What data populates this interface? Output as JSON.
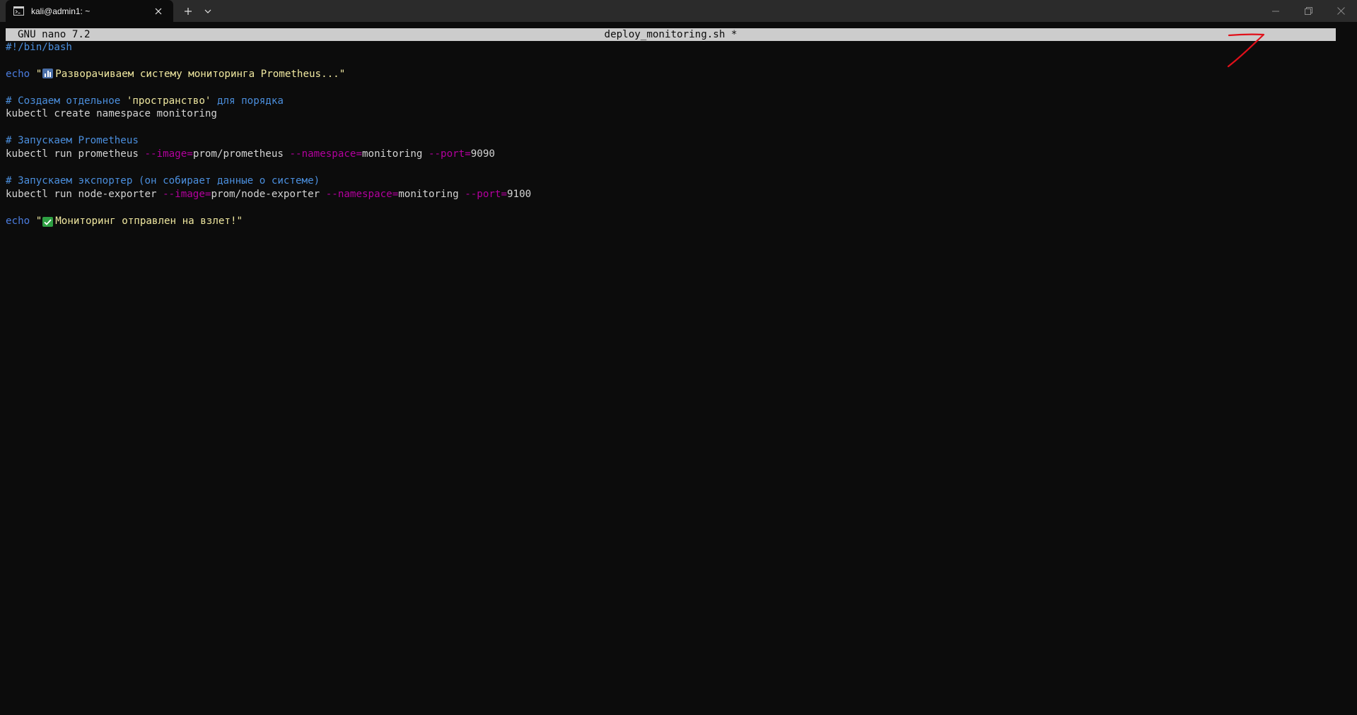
{
  "tab": {
    "icon": "terminal-icon",
    "title": "kali@admin1: ~"
  },
  "window_controls": [
    "minimize-icon",
    "restore-icon",
    "close-icon"
  ],
  "nano": {
    "version": "GNU nano 7.2",
    "filename": "deploy_monitoring.sh",
    "modified_marker": "*"
  },
  "editor": {
    "shebang": "#!/bin/bash",
    "echo1": {
      "keyword": "echo",
      "quote_open": "\"",
      "emoji": "bar-chart-emoji",
      "text": "Разворачиваем систему мониторинга Prometheus...\""
    },
    "comment1": {
      "part1": "# Создаем отдельное ",
      "quoted": "'пространство'",
      "part2": " для порядка"
    },
    "cmd1": "kubectl create namespace monitoring",
    "comment2": "# Запускаем Prometheus",
    "cmd2": {
      "base": "kubectl run prometheus ",
      "flag1": "--image=",
      "val1": "prom/prometheus ",
      "flag2": "--namespace=",
      "val2": "monitoring ",
      "flag3": "--port=",
      "val3": "9090"
    },
    "comment3": "# Запускаем экспортер (он собирает данные о системе)",
    "cmd3": {
      "base": "kubectl run node-exporter ",
      "flag1": "--image=",
      "val1": "prom/node-exporter ",
      "flag2": "--namespace=",
      "val2": "monitoring ",
      "flag3": "--port=",
      "val3": "9100"
    },
    "echo2": {
      "keyword": "echo",
      "quote_open": "\"",
      "emoji": "check-mark-emoji",
      "text": "Мониторинг отправлен на взлет!\""
    }
  },
  "colors": {
    "background": "#0c0c0c",
    "tabbar": "#2b2b2b",
    "header_bar": "#cccccc",
    "comment": "#4b8fde",
    "keyword": "#4b7de0",
    "string": "#f0e8a0",
    "flag": "#b4009e",
    "annotation": "#e0101a"
  }
}
